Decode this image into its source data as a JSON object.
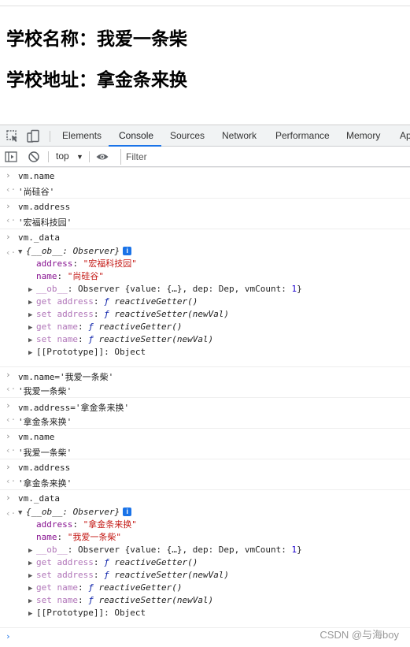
{
  "page": {
    "heading1": "学校名称：我爱一条柴",
    "heading2": "学校地址：拿金条来换"
  },
  "devtools": {
    "tabs": [
      "Elements",
      "Console",
      "Sources",
      "Network",
      "Performance",
      "Memory",
      "Ap"
    ],
    "active_tab": "Console",
    "context": "top",
    "filter_placeholder": "Filter"
  },
  "console": {
    "cmd1": "vm.name",
    "out1": "'尚硅谷'",
    "cmd2": "vm.address",
    "out2": "'宏福科技园'",
    "cmd3": "vm._data",
    "obj1": {
      "header": "{__ob__: Observer}",
      "address_key": "address",
      "address_val": "\"宏福科技园\"",
      "name_key": "name",
      "name_val": "\"尚硅谷\"",
      "ob_line_key": "__ob__",
      "ob_line_val": "Observer {value: {…}, dep: Dep, vmCount: ",
      "ob_line_num": "1",
      "get_address": "get address",
      "set_address": "set address",
      "get_name": "get name",
      "set_name": "set name",
      "getter": "reactiveGetter()",
      "setter": "reactiveSetter(newVal)",
      "proto": "[[Prototype]]: Object"
    },
    "cmd4": "vm.name='我爱一条柴'",
    "out4": "'我爱一条柴'",
    "cmd5": "vm.address='拿金条来换'",
    "out5": "'拿金条来换'",
    "cmd6": "vm.name",
    "out6": "'我爱一条柴'",
    "cmd7": "vm.address",
    "out7": "'拿金条来换'",
    "cmd8": "vm._data",
    "obj2": {
      "header": "{__ob__: Observer}",
      "address_key": "address",
      "address_val": "\"拿金条来换\"",
      "name_key": "name",
      "name_val": "\"我爱一条柴\"",
      "ob_line_key": "__ob__",
      "ob_line_val": "Observer {value: {…}, dep: Dep, vmCount: ",
      "ob_line_num": "1",
      "get_address": "get address",
      "set_address": "set address",
      "get_name": "get name",
      "set_name": "set name",
      "getter": "reactiveGetter()",
      "setter": "reactiveSetter(newVal)",
      "proto": "[[Prototype]]: Object"
    }
  },
  "watermark": "CSDN @与海boy"
}
